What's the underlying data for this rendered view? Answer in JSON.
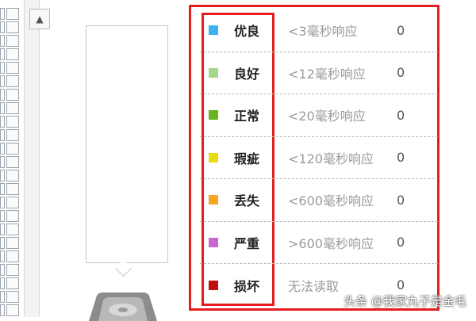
{
  "legend": {
    "rows": [
      {
        "label": "优良",
        "desc": "<3毫秒响应",
        "count": "0",
        "color": "#3ab3f0",
        "icon": "square-swatch-icon"
      },
      {
        "label": "良好",
        "desc": "<12毫秒响应",
        "count": "0",
        "color": "#a6d889",
        "icon": "square-swatch-icon"
      },
      {
        "label": "正常",
        "desc": "<20毫秒响应",
        "count": "0",
        "color": "#6ab51f",
        "icon": "square-swatch-icon"
      },
      {
        "label": "瑕疵",
        "desc": "<120毫秒响应",
        "count": "0",
        "color": "#e7dc12",
        "icon": "square-swatch-icon"
      },
      {
        "label": "丢失",
        "desc": "<600毫秒响应",
        "count": "0",
        "color": "#f5a623",
        "icon": "square-swatch-icon"
      },
      {
        "label": "严重",
        "desc": ">600毫秒响应",
        "count": "0",
        "color": "#cc66cc",
        "icon": "square-swatch-icon"
      },
      {
        "label": "损坏",
        "desc": "无法读取",
        "count": "0",
        "color": "#c0100e",
        "icon": "square-swatch-icon"
      }
    ]
  },
  "scrollbar": {
    "up_glyph": "▲"
  },
  "watermark": "头条 @我家丸子是金毛",
  "annotation_color": "#e41e1e"
}
